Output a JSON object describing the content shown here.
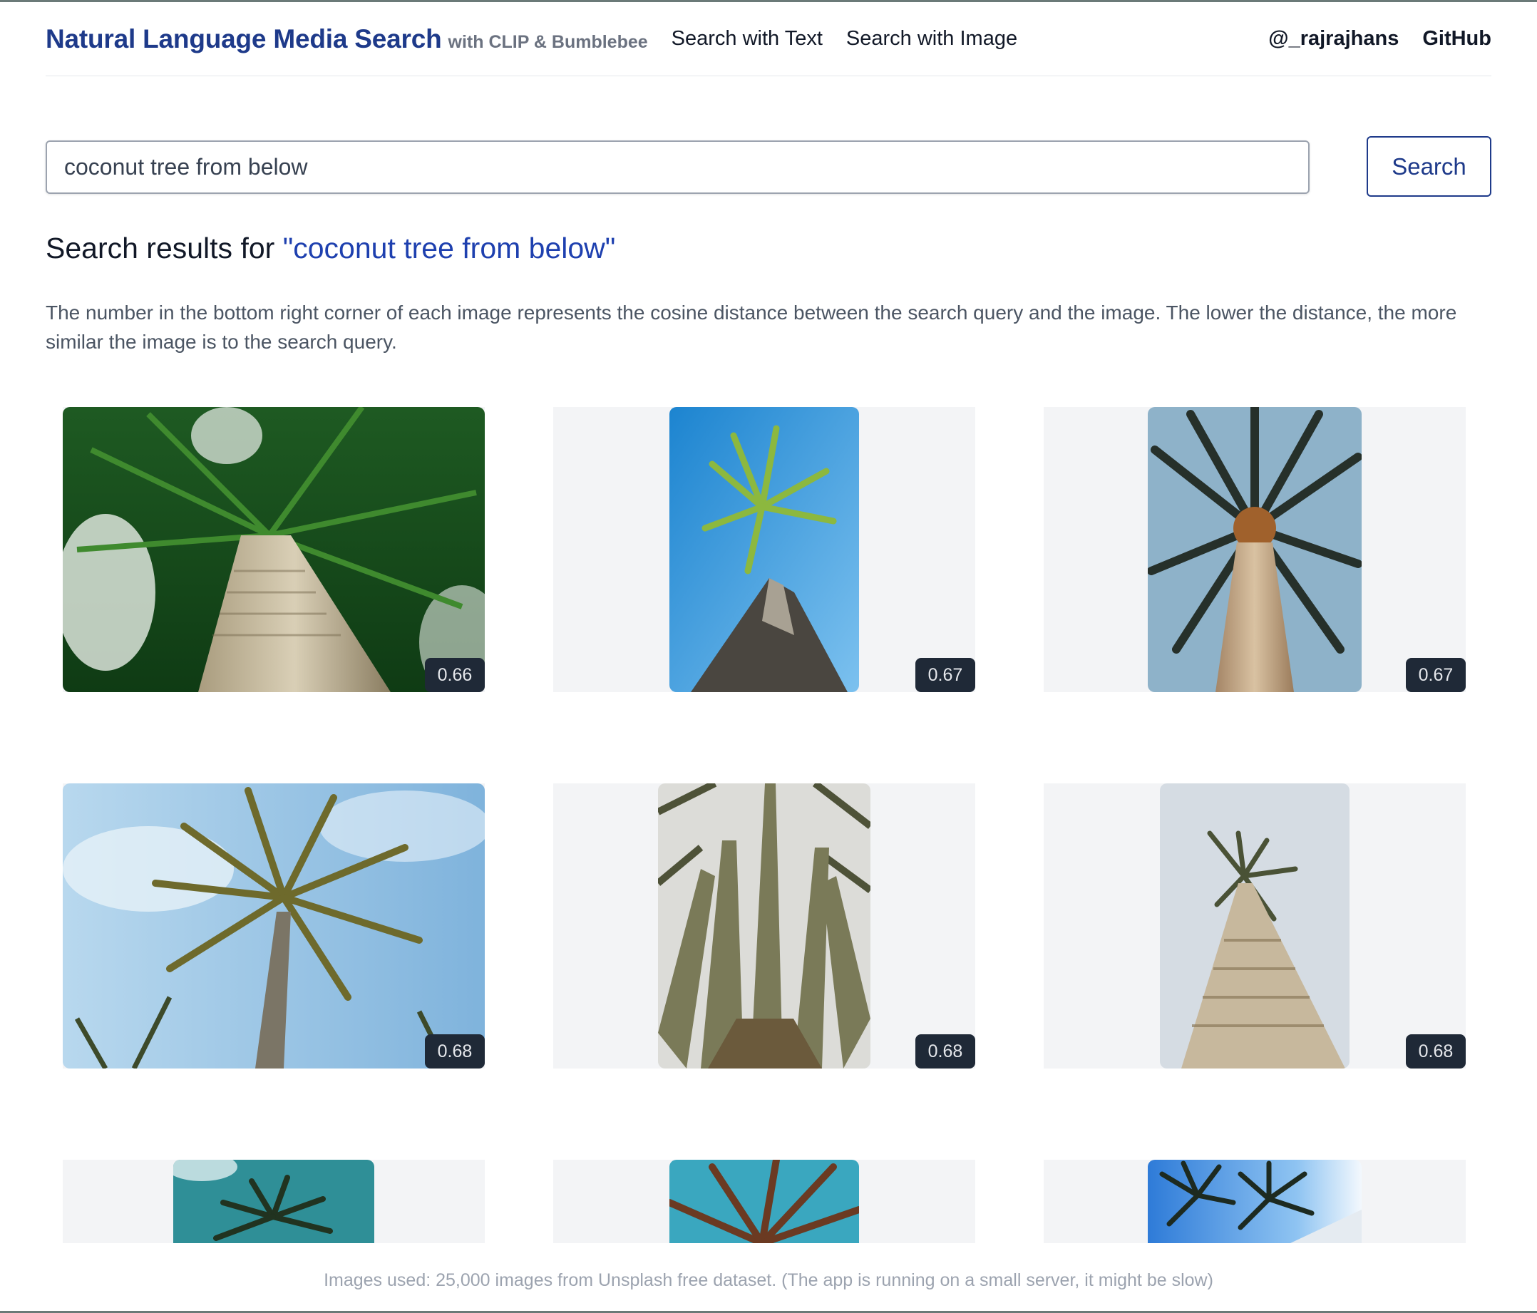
{
  "header": {
    "title": "Natural Language Media Search",
    "subtitle": "with CLIP & Bumblebee",
    "nav": [
      "Search with Text",
      "Search with Image"
    ],
    "right_links": [
      "@_rajrajhans",
      "GitHub"
    ]
  },
  "search": {
    "value": "coconut tree from below",
    "button_label": "Search"
  },
  "results": {
    "heading_prefix": "Search results for ",
    "heading_query": "\"coconut tree from below\"",
    "description": "The number in the bottom right corner of each image represents the cosine distance between the search query and the image. The lower the distance, the more similar the image is to the search query.",
    "items": [
      {
        "distance": "0.66",
        "image": "coconut-palm-canopy-photo"
      },
      {
        "distance": "0.67",
        "image": "palm-blue-sky-photo"
      },
      {
        "distance": "0.67",
        "image": "date-palm-trunk-photo"
      },
      {
        "distance": "0.68",
        "image": "palm-cloudy-sky-photo"
      },
      {
        "distance": "0.68",
        "image": "palm-fronds-closeup-photo"
      },
      {
        "distance": "0.68",
        "image": "palm-trunk-grey-sky-photo"
      },
      {
        "distance": "",
        "image": "palm-teal-sky-photo"
      },
      {
        "distance": "",
        "image": "palm-dark-fronds-photo"
      },
      {
        "distance": "",
        "image": "twin-palms-photo"
      }
    ]
  },
  "footer": {
    "text": "Images used: 25,000 images from Unsplash free dataset. (The app is running on a small server, it might be slow)"
  },
  "colors": {
    "brand": "#1e3a8a",
    "badge_bg": "#1f2937",
    "cell_bg": "#f3f4f6"
  }
}
